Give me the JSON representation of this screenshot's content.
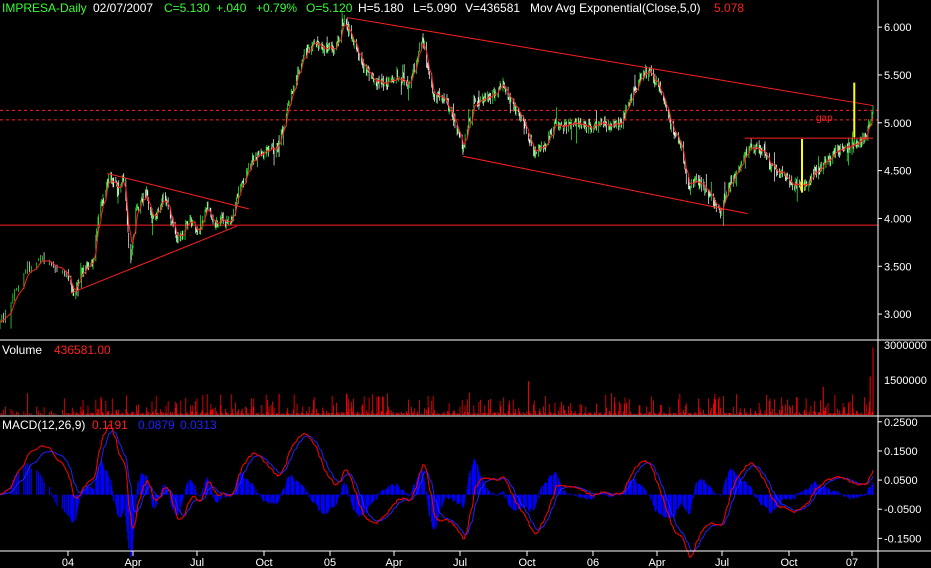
{
  "colors": {
    "background": "#000000",
    "grid_border": "#ffffff",
    "header_green": "#33ff33",
    "header_white": "#ffffff",
    "ema_value": "#ff2020",
    "trend_line": "#ff2020",
    "support_line": "#ff2020",
    "gap_line": "#ff2020",
    "yellow": "#ffff00",
    "volume_bars": "#ff0000",
    "macd_line": "#ff0000",
    "signal_line": "#2020ff",
    "histogram": "#0000ff",
    "up_candle": "#33ff33",
    "down_candle": "#ffffff"
  },
  "header": {
    "symbol": "IMPRESA-Daily",
    "date": "02/07/2007",
    "close": "C=5.130",
    "change": "+.040",
    "change_pct": "+0.79%",
    "open": "O=5.120",
    "high": "H=5.180",
    "low": "L=5.090",
    "volume": "V=436581",
    "indicator": "Mov Avg Exponential(Close,5,0)",
    "indicator_value": "5.078"
  },
  "volume_panel": {
    "label": "Volume",
    "value": "436581.00",
    "ticks": [
      "3000000",
      "1500000"
    ]
  },
  "macd_panel": {
    "label": "MACD(12,26,9)",
    "macd": "0.1191",
    "signal": "0.0879",
    "histogram": "0.0313",
    "ticks": [
      "0.2500",
      "0.1500",
      "0.0500",
      "-0.0500",
      "-0.1500"
    ]
  },
  "annotation": {
    "gap_label": "gap"
  },
  "chart_data": {
    "type": "candlestick",
    "title": "IMPRESA-Daily",
    "y_ticks": [
      "6.000",
      "5.500",
      "5.000",
      "4.500",
      "4.000",
      "3.500",
      "3.000"
    ],
    "ylim": [
      2.75,
      6.2
    ],
    "x_ticks": [
      "04",
      "Apr",
      "Jul",
      "Oct",
      "05",
      "Apr",
      "Jul",
      "Oct",
      "06",
      "Apr",
      "Jul",
      "Oct",
      "07"
    ],
    "grid": false,
    "price_path": [
      [
        "2003-11-25",
        2.9
      ],
      [
        "2003-12-10",
        3.5
      ],
      [
        "2003-12-20",
        3.6
      ],
      [
        "2004-01-02",
        3.35
      ],
      [
        "2004-01-10",
        3.22
      ],
      [
        "2004-01-25",
        3.5
      ],
      [
        "2004-02-05",
        3.55
      ],
      [
        "2004-02-15",
        4.1
      ],
      [
        "2004-02-28",
        4.45
      ],
      [
        "2004-03-10",
        4.3
      ],
      [
        "2004-03-20",
        4.4
      ],
      [
        "2004-03-28",
        3.5
      ],
      [
        "2004-04-05",
        4.1
      ],
      [
        "2004-04-20",
        4.25
      ],
      [
        "2004-05-01",
        3.95
      ],
      [
        "2004-05-15",
        4.25
      ],
      [
        "2004-05-25",
        4.0
      ],
      [
        "2004-06-05",
        3.75
      ],
      [
        "2004-06-20",
        4.0
      ],
      [
        "2004-07-05",
        3.85
      ],
      [
        "2004-07-15",
        4.15
      ],
      [
        "2004-07-25",
        3.9
      ],
      [
        "2004-08-05",
        4.0
      ],
      [
        "2004-08-15",
        3.92
      ],
      [
        "2004-08-28",
        4.3
      ],
      [
        "2004-09-15",
        4.6
      ],
      [
        "2004-10-01",
        4.7
      ],
      [
        "2004-10-20",
        4.75
      ],
      [
        "2004-11-10",
        5.35
      ],
      [
        "2004-11-25",
        5.7
      ],
      [
        "2004-12-10",
        5.85
      ],
      [
        "2004-12-25",
        5.75
      ],
      [
        "2005-01-10",
        5.8
      ],
      [
        "2005-01-20",
        6.05
      ],
      [
        "2005-01-28",
        5.95
      ],
      [
        "2005-02-10",
        5.7
      ],
      [
        "2005-03-01",
        5.45
      ],
      [
        "2005-03-20",
        5.4
      ],
      [
        "2005-04-05",
        5.5
      ],
      [
        "2005-04-20",
        5.4
      ],
      [
        "2005-05-01",
        5.6
      ],
      [
        "2005-05-10",
        5.9
      ],
      [
        "2005-05-25",
        5.3
      ],
      [
        "2005-06-10",
        5.25
      ],
      [
        "2005-06-25",
        5.0
      ],
      [
        "2005-07-05",
        4.72
      ],
      [
        "2005-07-20",
        5.2
      ],
      [
        "2005-08-05",
        5.25
      ],
      [
        "2005-08-20",
        5.3
      ],
      [
        "2005-08-28",
        5.45
      ],
      [
        "2005-09-10",
        5.2
      ],
      [
        "2005-09-25",
        5.05
      ],
      [
        "2005-10-10",
        4.7
      ],
      [
        "2005-10-25",
        4.75
      ],
      [
        "2005-11-10",
        5.0
      ],
      [
        "2005-11-25",
        4.95
      ],
      [
        "2005-12-10",
        5.0
      ],
      [
        "2005-12-25",
        4.95
      ],
      [
        "2006-01-10",
        5.0
      ],
      [
        "2006-01-25",
        4.98
      ],
      [
        "2006-02-10",
        5.0
      ],
      [
        "2006-02-25",
        5.3
      ],
      [
        "2006-03-10",
        5.5
      ],
      [
        "2006-03-20",
        5.55
      ],
      [
        "2006-04-05",
        5.35
      ],
      [
        "2006-04-20",
        5.0
      ],
      [
        "2006-05-05",
        4.75
      ],
      [
        "2006-05-15",
        4.3
      ],
      [
        "2006-05-25",
        4.4
      ],
      [
        "2006-06-10",
        4.3
      ],
      [
        "2006-06-28",
        4.05
      ],
      [
        "2006-07-10",
        4.35
      ],
      [
        "2006-07-25",
        4.55
      ],
      [
        "2006-08-10",
        4.75
      ],
      [
        "2006-08-25",
        4.7
      ],
      [
        "2006-09-10",
        4.5
      ],
      [
        "2006-09-25",
        4.45
      ],
      [
        "2006-10-10",
        4.35
      ],
      [
        "2006-10-25",
        4.35
      ],
      [
        "2006-11-10",
        4.5
      ],
      [
        "2006-11-25",
        4.6
      ],
      [
        "2006-12-10",
        4.7
      ],
      [
        "2006-12-25",
        4.75
      ],
      [
        "2007-01-10",
        4.8
      ],
      [
        "2007-01-25",
        4.85
      ],
      [
        "2007-02-07",
        5.13
      ]
    ],
    "ema_period": 5,
    "volume_max": 3000000,
    "support_level": 3.93,
    "gap_levels": [
      5.13,
      5.03
    ],
    "trendlines": [
      {
        "from": [
          "2004-01-05",
          3.22
        ],
        "to": [
          "2004-08-25",
          3.92
        ]
      },
      {
        "from": [
          "2004-02-25",
          4.47
        ],
        "to": [
          "2004-09-10",
          4.1
        ]
      },
      {
        "from": [
          "2005-01-25",
          6.1
        ],
        "to": [
          "2007-02-07",
          5.18
        ]
      },
      {
        "from": [
          "2005-07-05",
          4.65
        ],
        "to": [
          "2006-08-05",
          4.05
        ]
      }
    ],
    "horizontal_segments": [
      {
        "from": [
          "2006-08-01",
          4.84
        ],
        "to": [
          "2007-02-07",
          4.84
        ]
      }
    ],
    "yellow_markers": [
      {
        "date": "2006-10-20",
        "from": 4.27,
        "to": 4.83
      },
      {
        "date": "2007-01-05",
        "from": 4.85,
        "to": 5.42
      }
    ],
    "macd": {
      "ylim": [
        -0.19,
        0.27
      ],
      "current": [
        0.1191,
        0.0879,
        0.0313
      ]
    }
  }
}
